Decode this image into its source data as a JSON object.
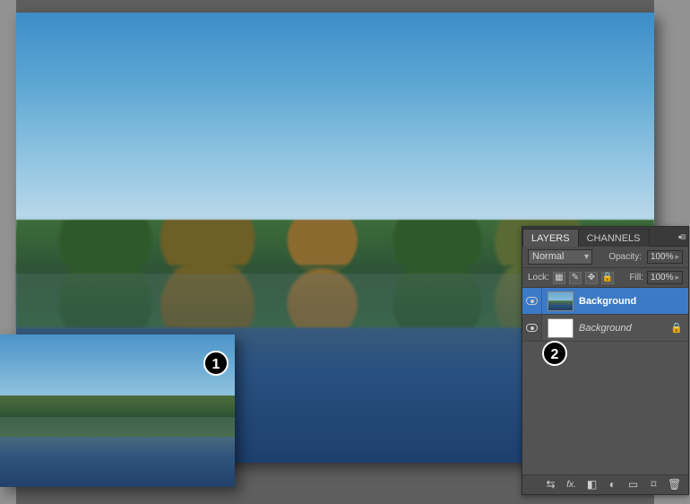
{
  "badges": {
    "one": "1",
    "two": "2"
  },
  "panel": {
    "tabs": {
      "layers": "LAYERS",
      "channels": "CHANNELS"
    },
    "blend_mode": "Normal",
    "opacity_label": "Opacity:",
    "opacity_value": "100%",
    "lock_label": "Lock:",
    "fill_label": "Fill:",
    "fill_value": "100%",
    "layers": [
      {
        "name": "Background",
        "selected": true,
        "bold": true,
        "locked": false,
        "white": false
      },
      {
        "name": "Background",
        "selected": false,
        "bold": false,
        "locked": true,
        "white": true
      }
    ],
    "footer_icons": {
      "link": "⌘",
      "fx": "fx.",
      "mask": "◧",
      "adjust": "◐",
      "group": "▭",
      "new": "⌑",
      "trash": "🗑"
    }
  }
}
